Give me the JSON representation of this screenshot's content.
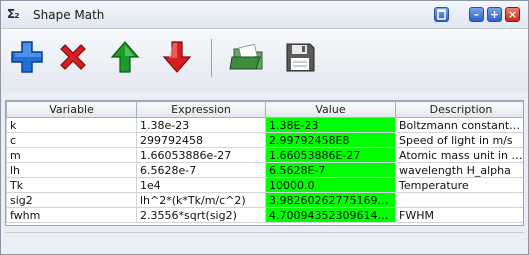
{
  "window": {
    "title": "Shape Math",
    "app_icon_glyph": "Σ₂",
    "controls": {
      "restore_icon": "window-restore-icon",
      "minimize_glyph": "–",
      "maximize_glyph": "+",
      "close_glyph": "×"
    }
  },
  "toolbar": {
    "buttons": [
      {
        "name": "add",
        "icon": "plus-icon",
        "color": "#1e6fd6"
      },
      {
        "name": "delete",
        "icon": "x-icon",
        "color": "#d81e1e"
      },
      {
        "name": "move-up",
        "icon": "arrow-up-icon",
        "color": "#1e9a2a"
      },
      {
        "name": "move-down",
        "icon": "arrow-down-icon",
        "color": "#d81e1e"
      },
      {
        "name": "open",
        "icon": "folder-open-icon",
        "color": "#3e8a3e"
      },
      {
        "name": "save",
        "icon": "floppy-disk-icon",
        "color": "#555555"
      }
    ]
  },
  "table": {
    "columns": [
      "Variable",
      "Expression",
      "Value",
      "Description"
    ],
    "value_highlight_color": "#00ff00",
    "rows": [
      {
        "variable": "k",
        "expression": "1.38e-23",
        "value": "1.38E-23",
        "description": "Boltzmann constant ..."
      },
      {
        "variable": "c",
        "expression": "299792458",
        "value": "2.99792458E8",
        "description": "Speed of light in m/s"
      },
      {
        "variable": "m",
        "expression": "1.66053886e-27",
        "value": "1.66053886E-27",
        "description": "Atomic mass unit in kg"
      },
      {
        "variable": "lh",
        "expression": "6.5628e-7",
        "value": "6.5628E-7",
        "description": "wavelength H_alpha"
      },
      {
        "variable": "Tk",
        "expression": "1e4",
        "value": "10000.0",
        "description": "Temperature"
      },
      {
        "variable": "sig2",
        "expression": "lh^2*(k*Tk/m/c^2)",
        "value": "3.982602627751692...",
        "description": ""
      },
      {
        "variable": "fwhm",
        "expression": "2.3556*sqrt(sig2)",
        "value": "4.70094352309614E...",
        "description": "FWHM"
      }
    ]
  }
}
